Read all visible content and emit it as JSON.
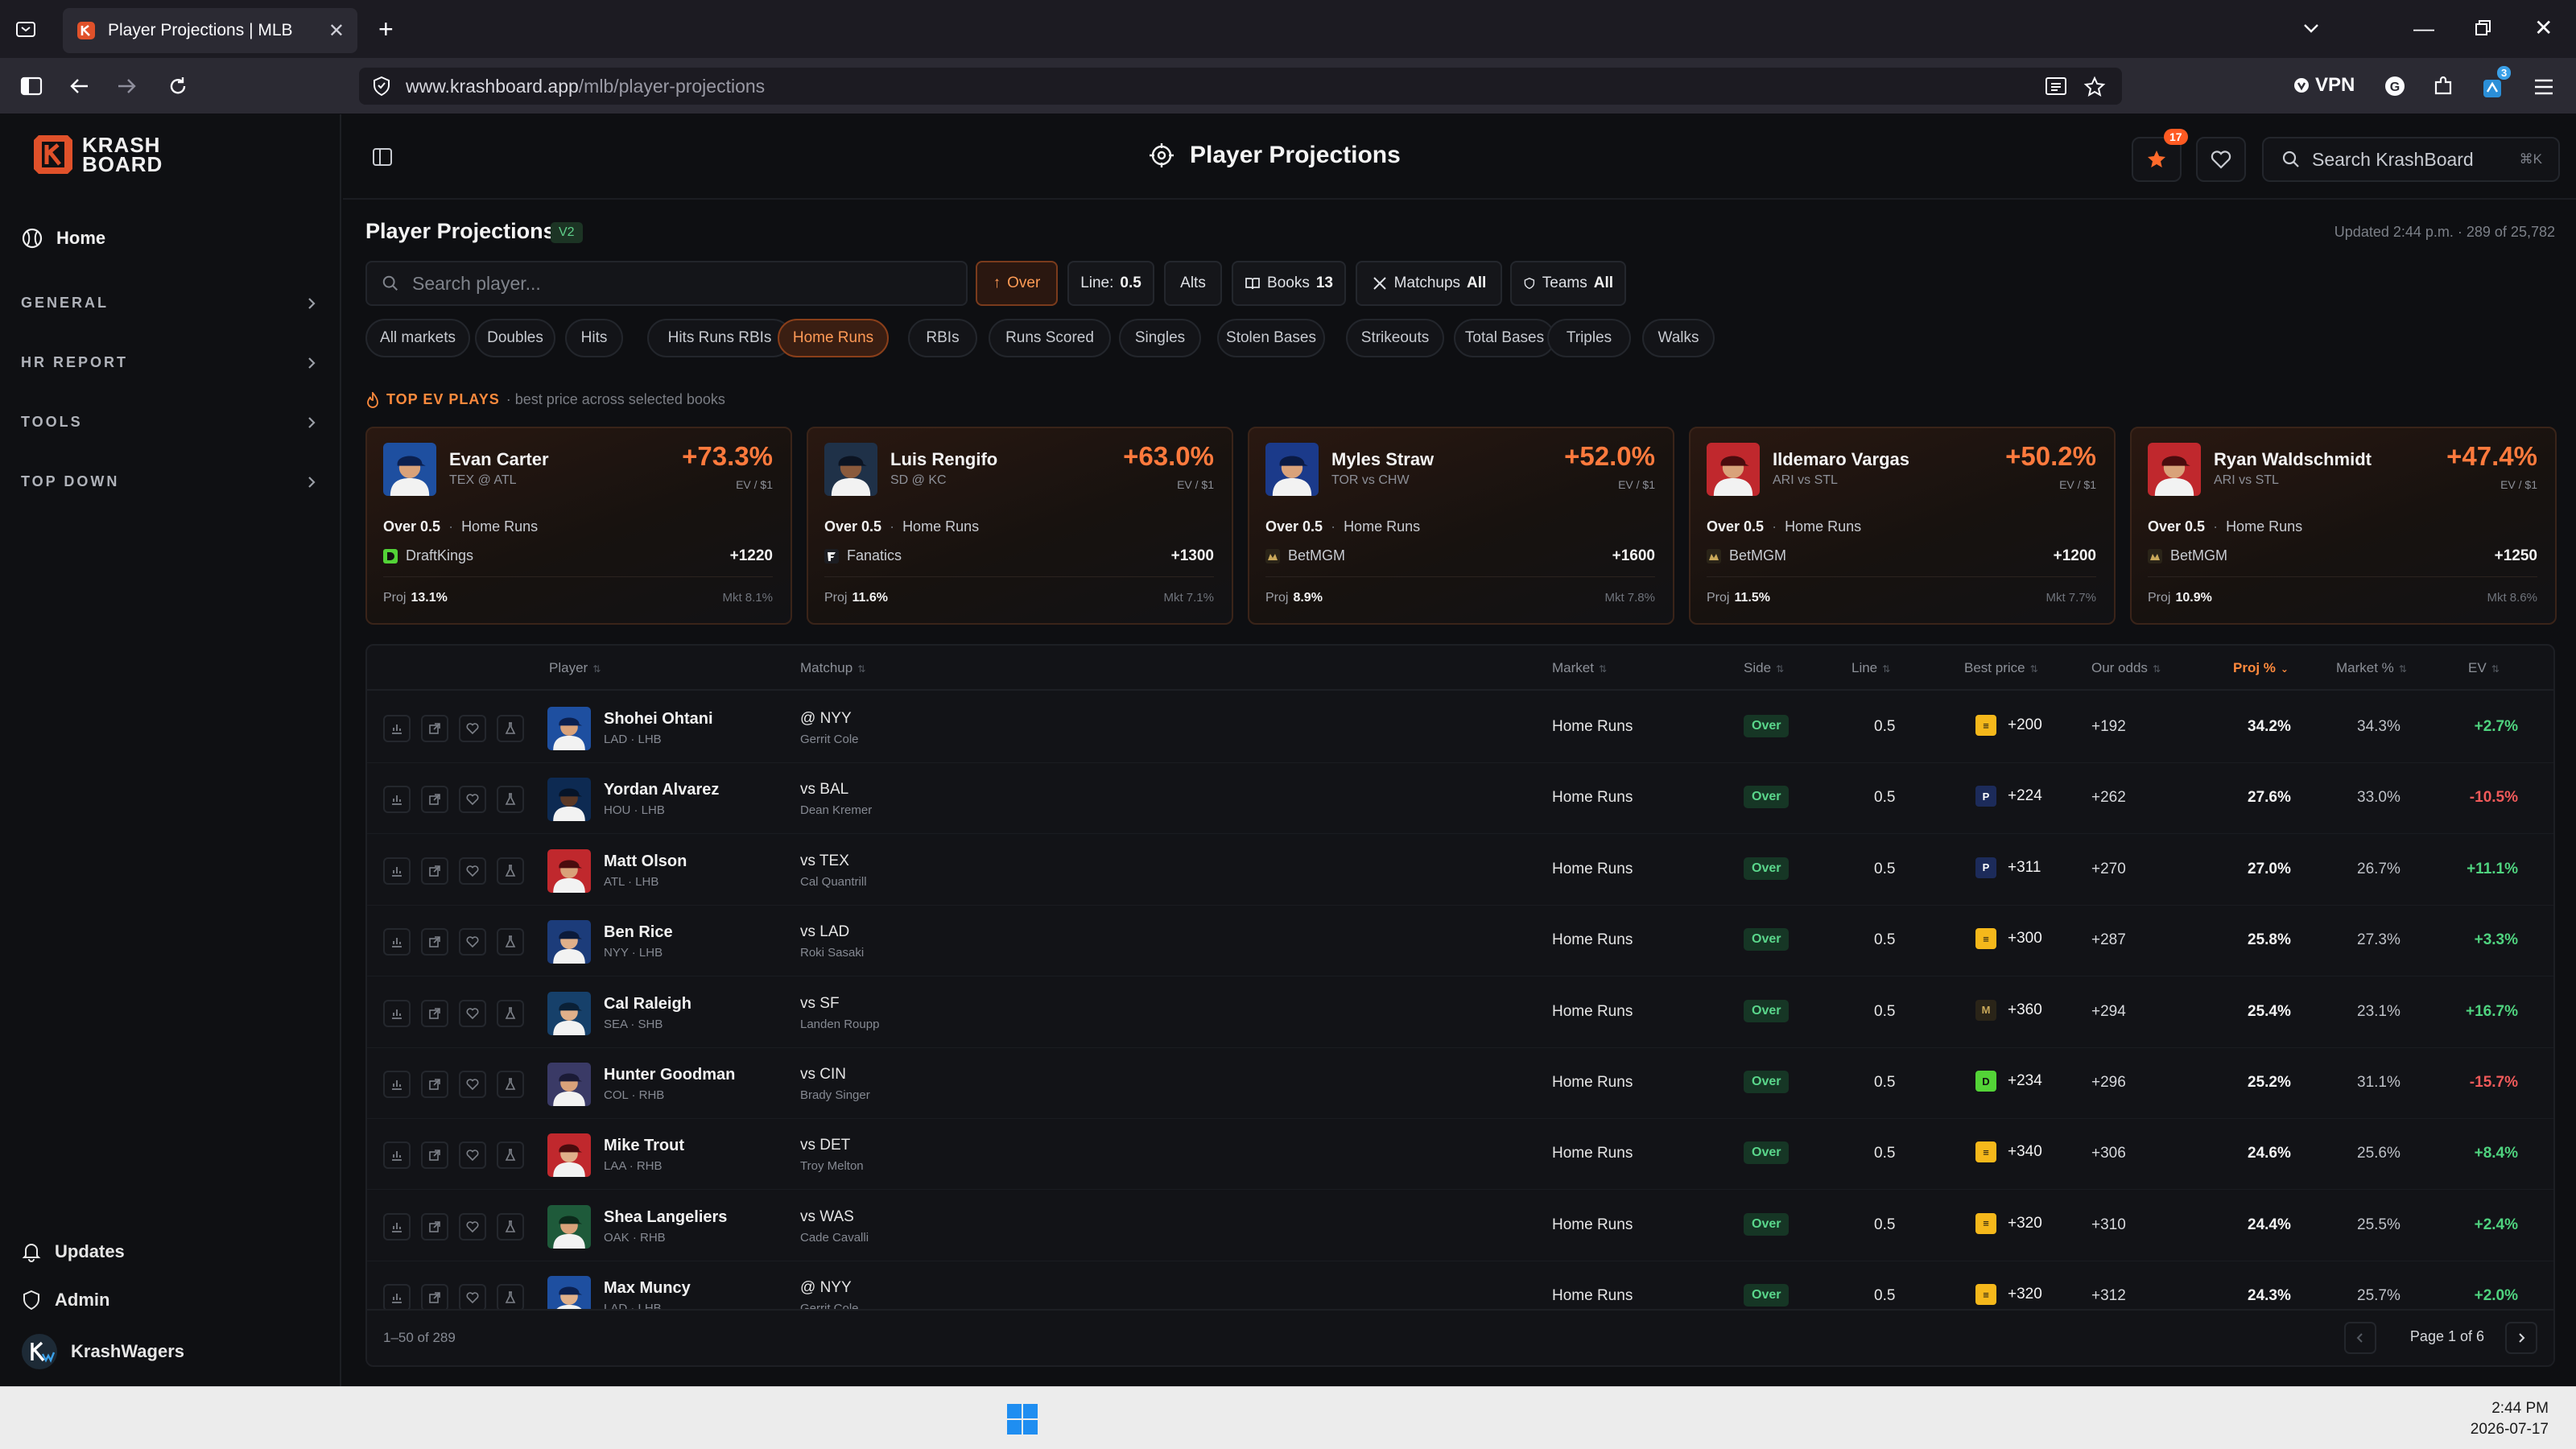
{
  "browser": {
    "tab_title": "Player Projections | MLB",
    "url_host": "www.krashboard.app",
    "url_path": "/mlb/player-projections",
    "vpn_label": "VPN",
    "extension_badge": "3"
  },
  "sidebar": {
    "logo_line1": "KRASH",
    "logo_line2": "BOARD",
    "home": "Home",
    "groups": [
      "GENERAL",
      "HR REPORT",
      "TOOLS",
      "TOP DOWN"
    ],
    "updates": "Updates",
    "admin": "Admin",
    "account": "KrashWagers"
  },
  "header": {
    "title": "Player Projections",
    "star_badge": "17",
    "search_placeholder": "Search KrashBoard",
    "search_shortcut": "⌘K"
  },
  "content": {
    "title": "Player Projections",
    "version": "V2",
    "updated": "Updated 2:44 p.m.  ·  289 of 25,782",
    "search_placeholder": "Search player...",
    "filters": {
      "side": "Over",
      "line_label": "Line:",
      "line_value": "0.5",
      "alts": "Alts",
      "books_label": "Books",
      "books_value": "13",
      "matchups_label": "Matchups",
      "matchups_value": "All",
      "teams_label": "Teams",
      "teams_value": "All"
    },
    "market_tabs": [
      "All markets",
      "Doubles",
      "Hits",
      "Hits Runs RBIs",
      "Home Runs",
      "RBIs",
      "Runs Scored",
      "Singles",
      "Stolen Bases",
      "Strikeouts",
      "Total Bases",
      "Triples",
      "Walks"
    ],
    "active_market": "Home Runs",
    "top_ev_label": "TOP EV PLAYS",
    "top_ev_sub": "· best price across selected books"
  },
  "cards": [
    {
      "name": "Evan Carter",
      "matchup": "TEX @ ATL",
      "ev": "+73.3%",
      "ev_sub": "EV / $1",
      "line": "Over 0.5",
      "market": "Home Runs",
      "book": "DraftKings",
      "price": "+1220",
      "proj": "13.1%",
      "mkt": "Mkt 8.1%"
    },
    {
      "name": "Luis Rengifo",
      "matchup": "SD @ KC",
      "ev": "+63.0%",
      "ev_sub": "EV / $1",
      "line": "Over 0.5",
      "market": "Home Runs",
      "book": "Fanatics",
      "price": "+1300",
      "proj": "11.6%",
      "mkt": "Mkt 7.1%"
    },
    {
      "name": "Myles Straw",
      "matchup": "TOR vs CHW",
      "ev": "+52.0%",
      "ev_sub": "EV / $1",
      "line": "Over 0.5",
      "market": "Home Runs",
      "book": "BetMGM",
      "price": "+1600",
      "proj": "8.9%",
      "mkt": "Mkt 7.8%"
    },
    {
      "name": "Ildemaro Vargas",
      "matchup": "ARI vs STL",
      "ev": "+50.2%",
      "ev_sub": "EV / $1",
      "line": "Over 0.5",
      "market": "Home Runs",
      "book": "BetMGM",
      "price": "+1200",
      "proj": "11.5%",
      "mkt": "Mkt 7.7%"
    },
    {
      "name": "Ryan Waldschmidt",
      "matchup": "ARI vs STL",
      "ev": "+47.4%",
      "ev_sub": "EV / $1",
      "line": "Over 0.5",
      "market": "Home Runs",
      "book": "BetMGM",
      "price": "+1250",
      "proj": "10.9%",
      "mkt": "Mkt 8.6%"
    }
  ],
  "proj_label": "Proj",
  "table": {
    "columns": [
      "Player",
      "Matchup",
      "Market",
      "Side",
      "Line",
      "Best price",
      "Our odds",
      "Proj %",
      "Market %",
      "EV"
    ],
    "rows": [
      {
        "name": "Shohei Ohtani",
        "team": "LAD · LHB",
        "matchup": "@ NYY",
        "pitcher": "Gerrit Cole",
        "market": "Home Runs",
        "side": "Over",
        "line": "0.5",
        "price": "+200",
        "odds": "+192",
        "proj": "34.2%",
        "mkt": "34.3%",
        "ev": "+2.7%"
      },
      {
        "name": "Yordan Alvarez",
        "team": "HOU · LHB",
        "matchup": "vs BAL",
        "pitcher": "Dean Kremer",
        "market": "Home Runs",
        "side": "Over",
        "line": "0.5",
        "price": "+224",
        "odds": "+262",
        "proj": "27.6%",
        "mkt": "33.0%",
        "ev": "-10.5%"
      },
      {
        "name": "Matt Olson",
        "team": "ATL · LHB",
        "matchup": "vs TEX",
        "pitcher": "Cal Quantrill",
        "market": "Home Runs",
        "side": "Over",
        "line": "0.5",
        "price": "+311",
        "odds": "+270",
        "proj": "27.0%",
        "mkt": "26.7%",
        "ev": "+11.1%"
      },
      {
        "name": "Ben Rice",
        "team": "NYY · LHB",
        "matchup": "vs LAD",
        "pitcher": "Roki Sasaki",
        "market": "Home Runs",
        "side": "Over",
        "line": "0.5",
        "price": "+300",
        "odds": "+287",
        "proj": "25.8%",
        "mkt": "27.3%",
        "ev": "+3.3%"
      },
      {
        "name": "Cal Raleigh",
        "team": "SEA · SHB",
        "matchup": "vs SF",
        "pitcher": "Landen Roupp",
        "market": "Home Runs",
        "side": "Over",
        "line": "0.5",
        "price": "+360",
        "odds": "+294",
        "proj": "25.4%",
        "mkt": "23.1%",
        "ev": "+16.7%"
      },
      {
        "name": "Hunter Goodman",
        "team": "COL · RHB",
        "matchup": "vs CIN",
        "pitcher": "Brady Singer",
        "market": "Home Runs",
        "side": "Over",
        "line": "0.5",
        "price": "+234",
        "odds": "+296",
        "proj": "25.2%",
        "mkt": "31.1%",
        "ev": "-15.7%"
      },
      {
        "name": "Mike Trout",
        "team": "LAA · RHB",
        "matchup": "vs DET",
        "pitcher": "Troy Melton",
        "market": "Home Runs",
        "side": "Over",
        "line": "0.5",
        "price": "+340",
        "odds": "+306",
        "proj": "24.6%",
        "mkt": "25.6%",
        "ev": "+8.4%"
      },
      {
        "name": "Shea Langeliers",
        "team": "OAK · RHB",
        "matchup": "vs WAS",
        "pitcher": "Cade Cavalli",
        "market": "Home Runs",
        "side": "Over",
        "line": "0.5",
        "price": "+320",
        "odds": "+310",
        "proj": "24.4%",
        "mkt": "25.5%",
        "ev": "+2.4%"
      },
      {
        "name": "Max Muncy",
        "team": "LAD · LHB",
        "matchup": "@ NYY",
        "pitcher": "Gerrit Cole",
        "market": "Home Runs",
        "side": "Over",
        "line": "0.5",
        "price": "+320",
        "odds": "+312",
        "proj": "24.3%",
        "mkt": "25.7%",
        "ev": "+2.0%"
      }
    ],
    "range": "1–50 of 289",
    "page": "Page 1 of 6"
  },
  "taskbar": {
    "time": "2:44 PM",
    "date": "2026-07-17"
  },
  "colors": {
    "accent": "#ff7a3d",
    "positive": "#4fd37f",
    "negative": "#f05a5a",
    "over_badge": "#5ad68b"
  }
}
